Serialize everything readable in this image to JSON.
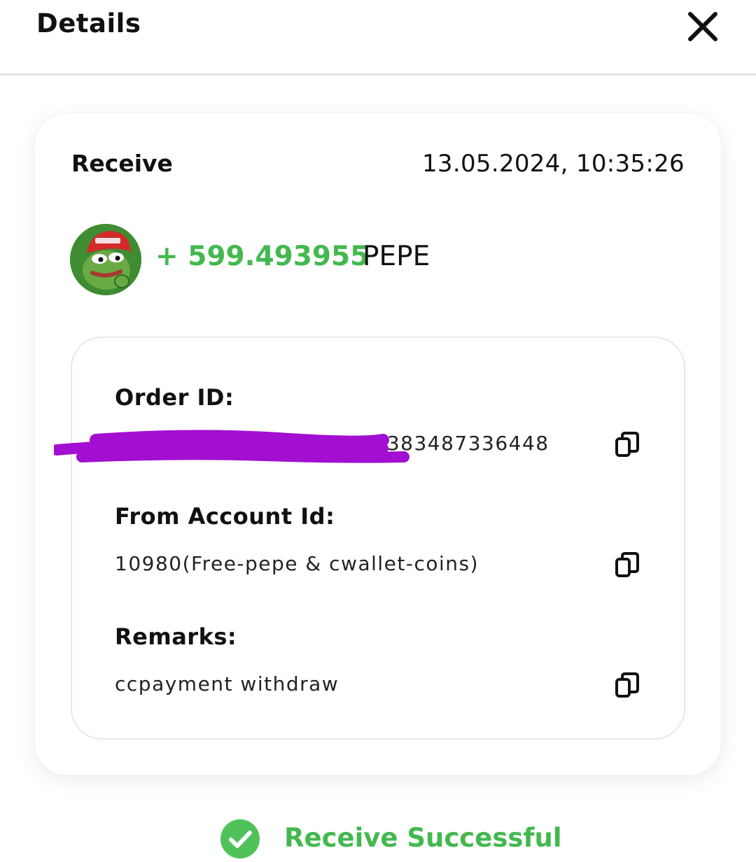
{
  "header": {
    "title": "Details",
    "close_icon": "close-icon"
  },
  "transaction": {
    "type": "Receive",
    "datetime": "13.05.2024, 10:35:26",
    "token_icon": "pepe-token-icon",
    "amount": "+ 599.493955",
    "currency": "PEPE",
    "amount_color": "#43b84f"
  },
  "details": {
    "order_id": {
      "label": "Order ID:",
      "value": "…2383487336448",
      "redacted": true
    },
    "from_account": {
      "label": "From Account Id:",
      "value": "10980(Free-pepe & cwallet-coins)"
    },
    "remarks": {
      "label": "Remarks:",
      "value": "ccpayment withdraw"
    },
    "copy_icon": "copy-icon"
  },
  "status": {
    "text": "Receive Successful",
    "icon": "check-circle-icon",
    "color": "#43b84f"
  },
  "redaction_color": "#a20fd0"
}
